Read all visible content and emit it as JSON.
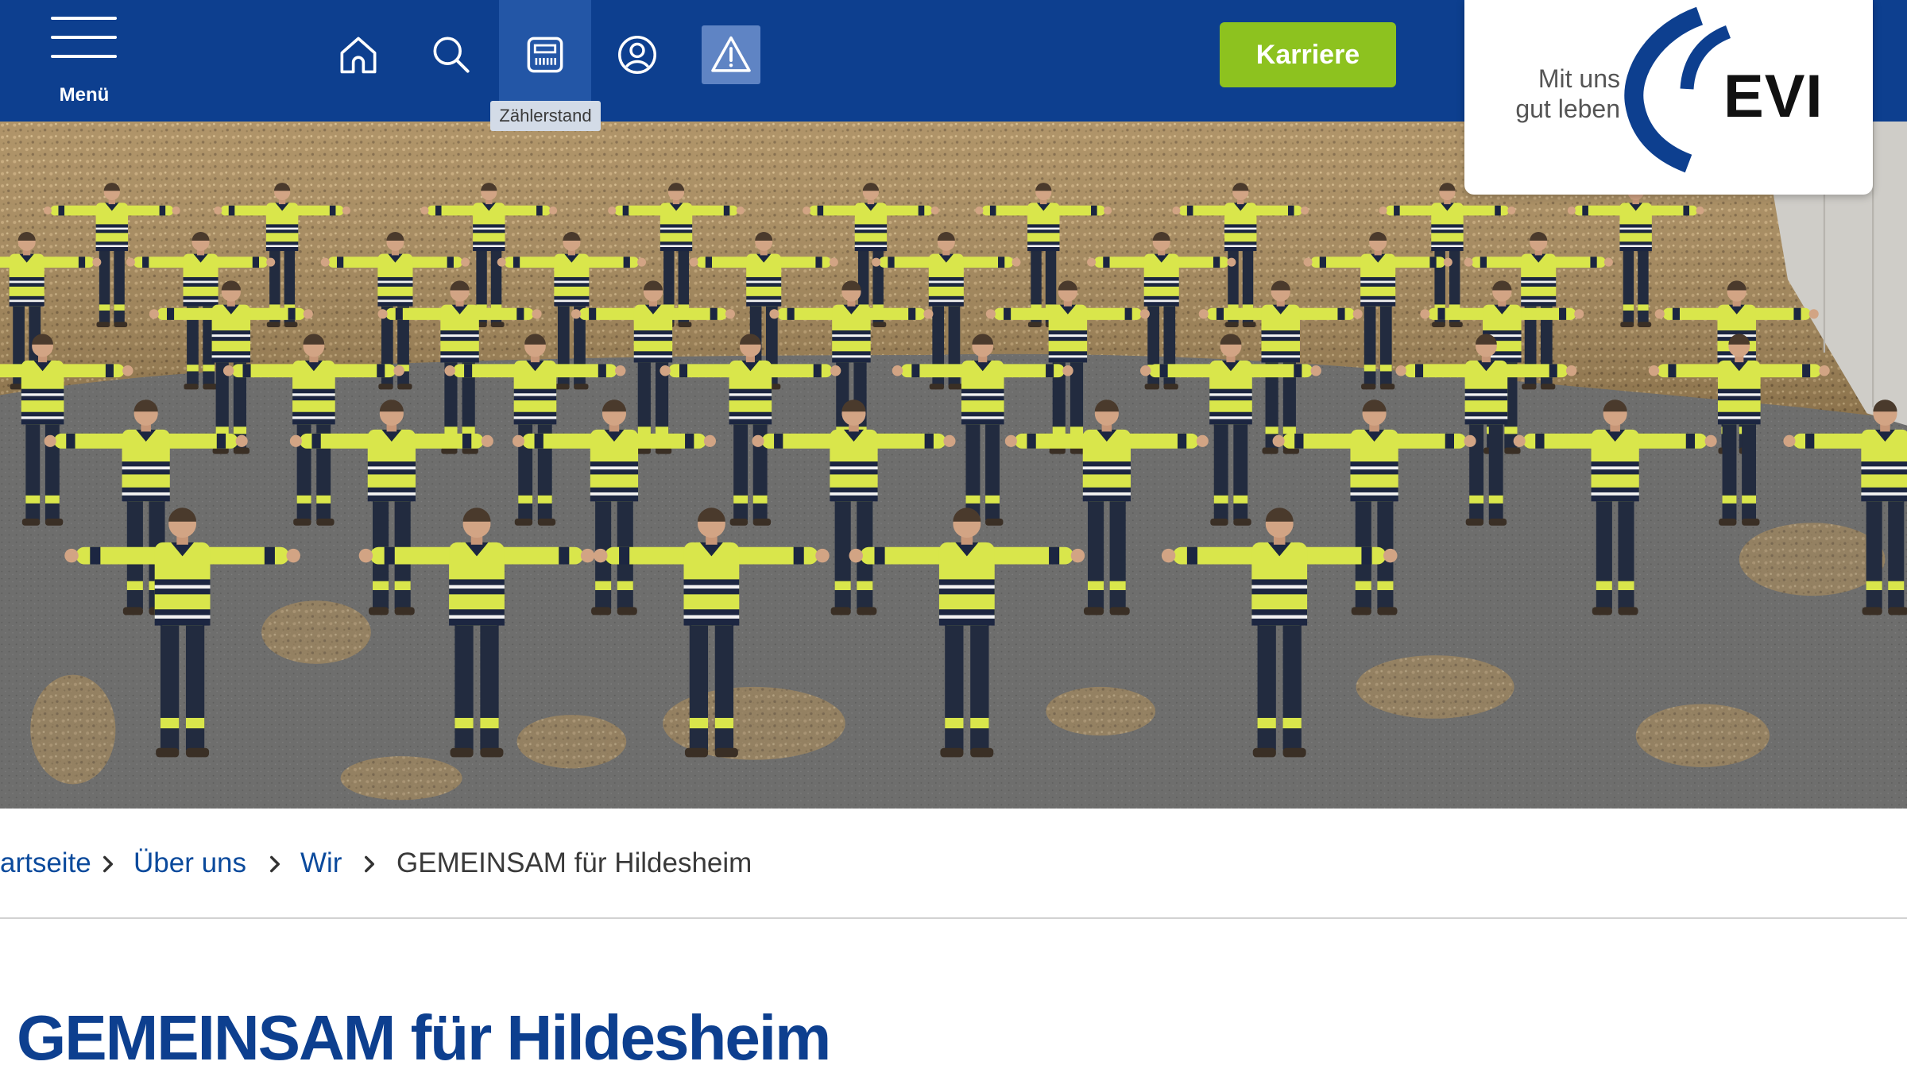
{
  "header": {
    "menu_label": "Menü",
    "menu_icon": "menu-icon",
    "nav": [
      {
        "icon": "home-icon"
      },
      {
        "icon": "search-icon"
      },
      {
        "icon": "meter-icon",
        "active": true,
        "tooltip": "Zählerstand"
      },
      {
        "icon": "user-icon"
      },
      {
        "icon": "warning-icon"
      }
    ],
    "career_button": "Karriere"
  },
  "logo": {
    "tagline": [
      "Mit uns",
      "gut leben"
    ],
    "brand": "EVI"
  },
  "breadcrumb": {
    "links": [
      "artseite",
      "Über uns",
      "Wir"
    ],
    "separator_icon": "chevron-right-icon",
    "current": "GEMEINSAM für Hildesheim"
  },
  "page_title": "GEMEINSAM für Hildesheim",
  "colors": {
    "header_bg": "#0d3f8f",
    "active_tab_bg": "#2356a6",
    "alert_tab_bg": "#5f84c4",
    "career_green": "#8dc21f",
    "link_blue": "#0b4a9c",
    "title_blue": "#0d3f8f",
    "text_dark": "#3a3a3a"
  }
}
